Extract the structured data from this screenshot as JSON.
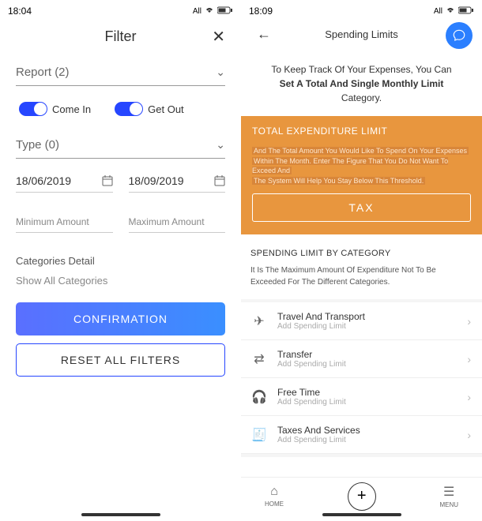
{
  "left": {
    "status": {
      "time": "18:04",
      "carrier": "All"
    },
    "header": {
      "title": "Filter"
    },
    "report": {
      "label": "Report (2)"
    },
    "toggles": {
      "come_in": "Come In",
      "get_out": "Get Out"
    },
    "type": {
      "label": "Type (0)"
    },
    "dates": {
      "from": "18/06/2019",
      "to": "18/09/2019"
    },
    "amounts": {
      "min": "Minimum Amount",
      "max": "Maximum Amount"
    },
    "categories": {
      "detail": "Categories Detail",
      "show_all": "Show All Categories"
    },
    "buttons": {
      "confirm": "CONFIRMATION",
      "reset": "RESET ALL FILTERS"
    }
  },
  "right": {
    "status": {
      "time": "18:09",
      "carrier": "All"
    },
    "header": {
      "title": "Spending Limits"
    },
    "intro": {
      "line1": "To Keep Track Of Your Expenses, You Can",
      "line2": "Set A Total And Single Monthly Limit",
      "line3": "Category."
    },
    "total": {
      "title": "TOTAL EXPENDITURE LIMIT",
      "desc1": "And The Total Amount You Would Like To Spend On Your Expenses",
      "desc2": "Within The Month. Enter The Figure That You Do Not Want To Exceed And",
      "desc3": "The System Will Help You Stay Below This Threshold.",
      "button": "TAX"
    },
    "bycat": {
      "title": "SPENDING LIMIT BY CATEGORY",
      "desc": "It Is The Maximum Amount Of Expenditure Not To Be Exceeded For The Different Categories."
    },
    "cats": [
      {
        "name": "Travel And Transport",
        "sub": "Add Spending Limit"
      },
      {
        "name": "Transfer",
        "sub": "Add Spending Limit"
      },
      {
        "name": "Free Time",
        "sub": "Add Spending Limit"
      },
      {
        "name": "Taxes And Services",
        "sub": "Add Spending Limit"
      }
    ],
    "nav": {
      "home": "HOME",
      "menu": "MENU"
    }
  }
}
